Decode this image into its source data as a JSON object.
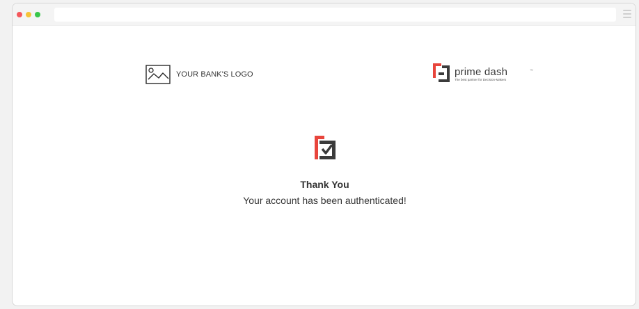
{
  "browser": {
    "traffic_lights": {
      "red": "#f4575b",
      "yellow": "#f6c338",
      "green": "#39c64a"
    }
  },
  "bank_logo": {
    "icon": "image-placeholder-icon",
    "label": "YOUR BANK'S LOGO"
  },
  "prime_dash": {
    "name": "prime dash",
    "trademark": "™",
    "tagline": "The best partner for Decision-Makers",
    "colors": {
      "red": "#e8453c",
      "dark": "#3b3b3b"
    }
  },
  "confirmation": {
    "icon": "check-mark-icon",
    "title": "Thank You",
    "message": "Your account has been authenticated!"
  }
}
